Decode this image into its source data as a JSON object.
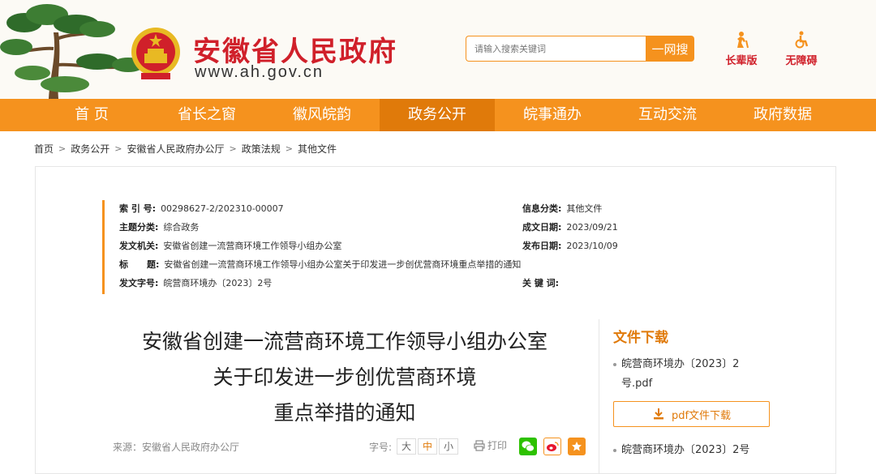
{
  "header": {
    "site_title": "安徽省人民政府",
    "site_url": "www.ah.gov.cn",
    "search": {
      "placeholder": "请输入搜索关键词",
      "button_label": "一网搜"
    },
    "tools": {
      "elder_label": "长辈版",
      "accessibility_label": "无障碍"
    }
  },
  "nav": {
    "items": [
      {
        "label": "首 页"
      },
      {
        "label": "省长之窗"
      },
      {
        "label": "徽风皖韵"
      },
      {
        "label": "政务公开"
      },
      {
        "label": "皖事通办"
      },
      {
        "label": "互动交流"
      },
      {
        "label": "政府数据"
      }
    ],
    "active_index": 3
  },
  "breadcrumb": [
    "首页",
    "政务公开",
    "安徽省人民政府办公厅",
    "政策法规",
    "其他文件"
  ],
  "meta": {
    "index_label": "索 引 号:",
    "index_value": "00298627-2/202310-00007",
    "subject_label": "主题分类:",
    "subject_value": "综合政务",
    "issuer_label": "发文机关:",
    "issuer_value": "安徽省创建一流营商环境工作领导小组办公室",
    "title_label": "标      题:",
    "title_value": "安徽省创建一流营商环境工作领导小组办公室关于印发进一步创优营商环境重点举措的通知",
    "docno_label": "发文字号:",
    "docno_value": "皖营商环境办〔2023〕2号",
    "info_category_label": "信息分类:",
    "info_category_value": "其他文件",
    "created_label": "成文日期:",
    "created_value": "2023/09/21",
    "published_label": "发布日期:",
    "published_value": "2023/10/09",
    "keywords_label": "关 键 词:",
    "keywords_value": ""
  },
  "article": {
    "title_line1": "安徽省创建一流营商环境工作领导小组办公室",
    "title_line2": "关于印发进一步创优营商环境",
    "title_line3": "重点举措的通知",
    "source": "来源：安徽省人民政府办公厅",
    "fontsize_label": "字号:",
    "fontsize_large": "大",
    "fontsize_medium": "中",
    "fontsize_small": "小",
    "print_label": "打印"
  },
  "download": {
    "title": "文件下载",
    "file1_line1": "皖营商环境办〔2023〕2",
    "file1_line2": "号.pdf",
    "button_label": "pdf文件下载",
    "file2": "皖营商环境办〔2023〕2号"
  },
  "colors": {
    "brand_orange": "#f5921e",
    "brand_red": "#d0202a",
    "active_orange": "#e07a0a"
  }
}
